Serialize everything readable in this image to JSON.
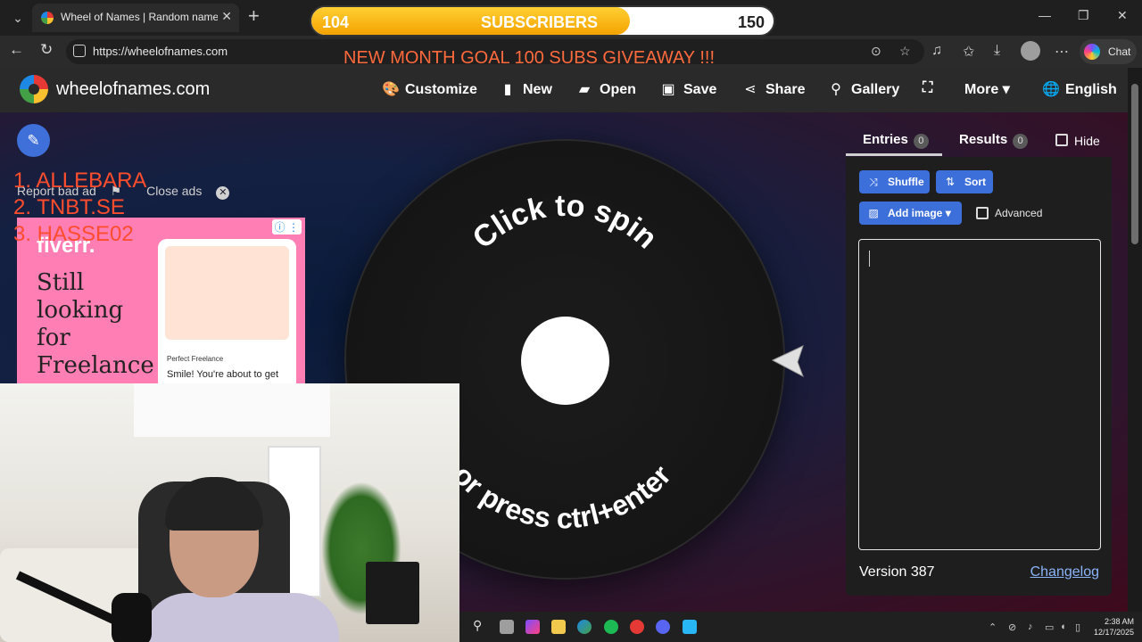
{
  "browser": {
    "tab_title": "Wheel of Names | Random name picker",
    "url": "https://wheelofnames.com",
    "copilot_label": "Chat"
  },
  "site": {
    "name": "wheelofnames.com",
    "nav": {
      "customize": "Customize",
      "new": "New",
      "open": "Open",
      "save": "Save",
      "share": "Share",
      "gallery": "Gallery",
      "more": "More",
      "language": "English"
    }
  },
  "ad": {
    "report_label": "Report bad ad",
    "close_label": "Close ads",
    "brand": "fiverr.",
    "headline": "Still looking for Freelance",
    "card_title": "Perfect Freelance",
    "card_body": "Smile! You're about to get the perfect shot."
  },
  "ranking": [
    "1.  ALLEBARA",
    "2.  TNBT.SE",
    "3.  HASSE02"
  ],
  "wheel": {
    "top_text": "Click to spin",
    "bottom_text": "or press ctrl+enter"
  },
  "panel": {
    "entries_label": "Entries",
    "entries_count": "0",
    "results_label": "Results",
    "results_count": "0",
    "hide_label": "Hide",
    "shuffle_label": "Shuffle",
    "sort_label": "Sort",
    "add_image_label": "Add image",
    "advanced_label": "Advanced",
    "version": "Version 387",
    "changelog_label": "Changelog"
  },
  "overlay": {
    "current_subs": "104",
    "bar_label": "SUBSCRIBERS",
    "goal_subs": "150",
    "progress_fraction": 0.69,
    "giveaway_text": "NEW MONTH GOAL 100 SUBS GIVEAWAY !!!"
  },
  "taskbar": {
    "time": "2:38 AM",
    "date": "12/17/2025"
  },
  "colors": {
    "accent_blue": "#3d6fdb",
    "subscriber_bar": "#f4a300",
    "overlay_text": "#ff6a3d"
  }
}
